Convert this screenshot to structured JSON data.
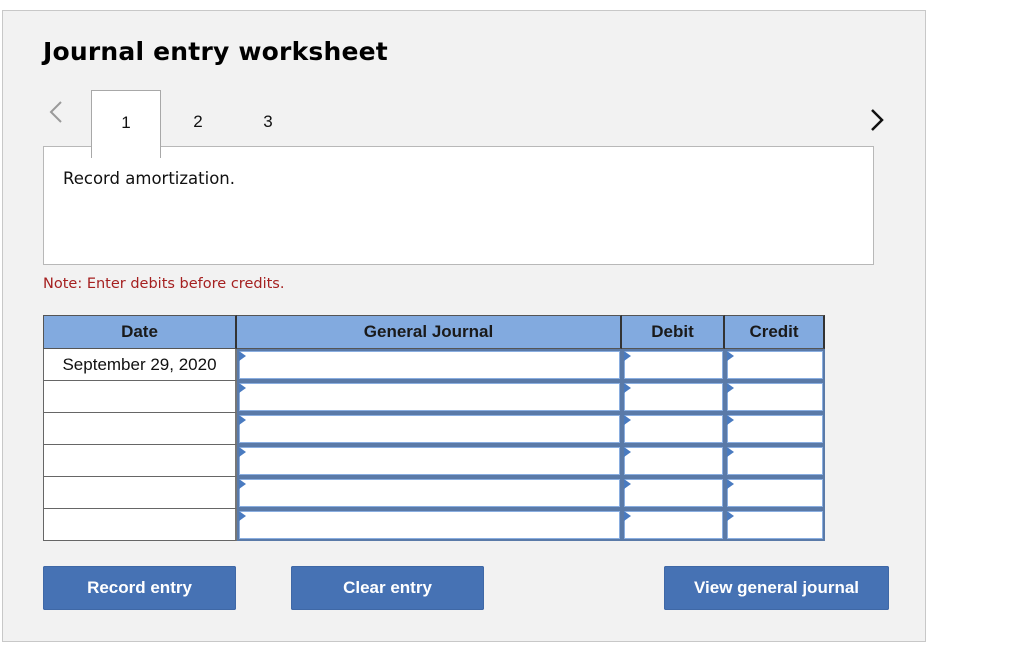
{
  "worksheet": {
    "title": "Journal entry worksheet",
    "nav": {
      "prev_icon": "chevron-left-icon",
      "next_icon": "chevron-right-icon"
    },
    "tabs": [
      {
        "label": "1",
        "active": true
      },
      {
        "label": "2",
        "active": false
      },
      {
        "label": "3",
        "active": false
      }
    ],
    "instruction": "Record amortization.",
    "note": "Note: Enter debits before credits.",
    "colors": {
      "header_bg": "#82aadf",
      "button_bg": "#4672b4",
      "note_text": "#a52020",
      "panel_bg": "#f2f2f2"
    }
  },
  "journal": {
    "columns": [
      "Date",
      "General Journal",
      "Debit",
      "Credit"
    ],
    "rows": [
      {
        "date": "September 29, 2020",
        "account": "",
        "debit": "",
        "credit": ""
      },
      {
        "date": "",
        "account": "",
        "debit": "",
        "credit": ""
      },
      {
        "date": "",
        "account": "",
        "debit": "",
        "credit": ""
      },
      {
        "date": "",
        "account": "",
        "debit": "",
        "credit": ""
      },
      {
        "date": "",
        "account": "",
        "debit": "",
        "credit": ""
      },
      {
        "date": "",
        "account": "",
        "debit": "",
        "credit": ""
      }
    ]
  },
  "buttons": {
    "record_entry": "Record entry",
    "clear_entry": "Clear entry",
    "view_general_journal": "View general journal"
  }
}
